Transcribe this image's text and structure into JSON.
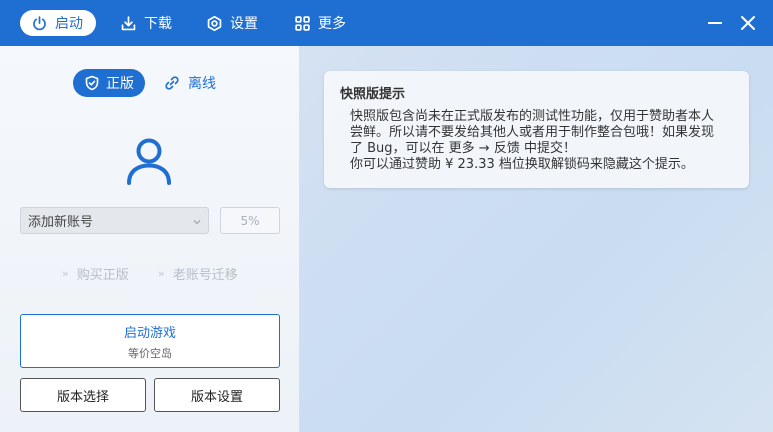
{
  "nav": {
    "items": [
      {
        "label": "启动",
        "icon": "power-icon",
        "active": true
      },
      {
        "label": "下载",
        "icon": "download-icon",
        "active": false
      },
      {
        "label": "设置",
        "icon": "settings-icon",
        "active": false
      },
      {
        "label": "更多",
        "icon": "grid-icon",
        "active": false
      }
    ],
    "window_controls": [
      "minimize-icon",
      "close-icon"
    ]
  },
  "colors": {
    "accent": "#1f6fd2",
    "titlebar": "#1f6fd2",
    "text": "#333333",
    "muted": "#b7bec8"
  },
  "left": {
    "mode_online": "正版",
    "mode_offline": "离线",
    "account_select": "添加新账号",
    "percent": "5%",
    "links": [
      "购买正版",
      "老账号迁移"
    ],
    "link_arrow": "»",
    "launch": {
      "title": "启动游戏",
      "subtitle": "等价空岛"
    },
    "version_select": "版本选择",
    "version_settings": "版本设置"
  },
  "hint": {
    "title": "快照版提示",
    "lines": [
      "快照版包含尚未在正式版发布的测试性功能，仅用于赞助者本人",
      "尝鲜。所以请不要发给其他人或者用于制作整合包哦！如果发现",
      "了 Bug，可以在 更多 → 反馈 中提交！",
      "你可以通过赞助 ¥ 23.33 档位换取解锁码来隐藏这个提示。"
    ]
  }
}
